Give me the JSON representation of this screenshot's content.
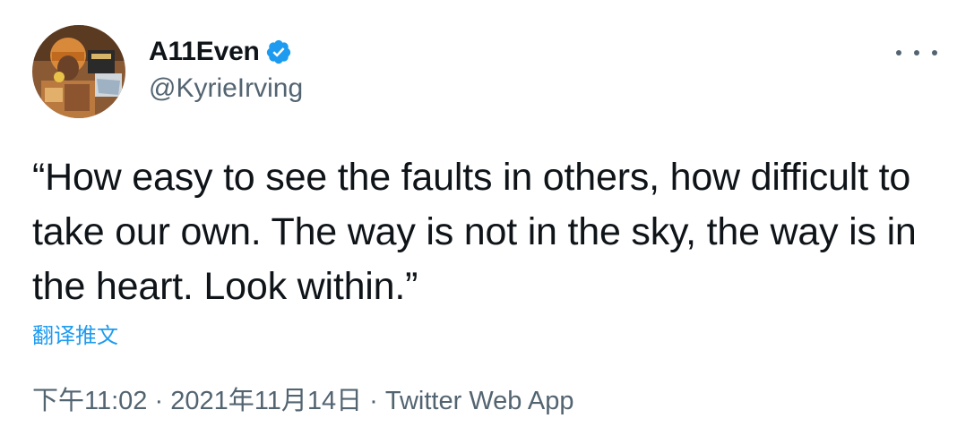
{
  "author": {
    "display_name": "A11Even",
    "handle": "@KyrieIrving",
    "verified": true
  },
  "tweet": {
    "text": "“How easy to see the faults in others, how difficult to take our own. The way is not in the sky, the way is in the heart. Look within.”",
    "translate_label": "翻译推文"
  },
  "meta": {
    "time": "下午11:02",
    "separator": " · ",
    "date": "2021年11月14日",
    "source": "Twitter Web App"
  },
  "colors": {
    "text_primary": "#0f1419",
    "text_secondary": "#536471",
    "accent": "#1d9bf0"
  },
  "icons": {
    "verified": "verified-badge-icon",
    "more": "more-options-icon"
  }
}
